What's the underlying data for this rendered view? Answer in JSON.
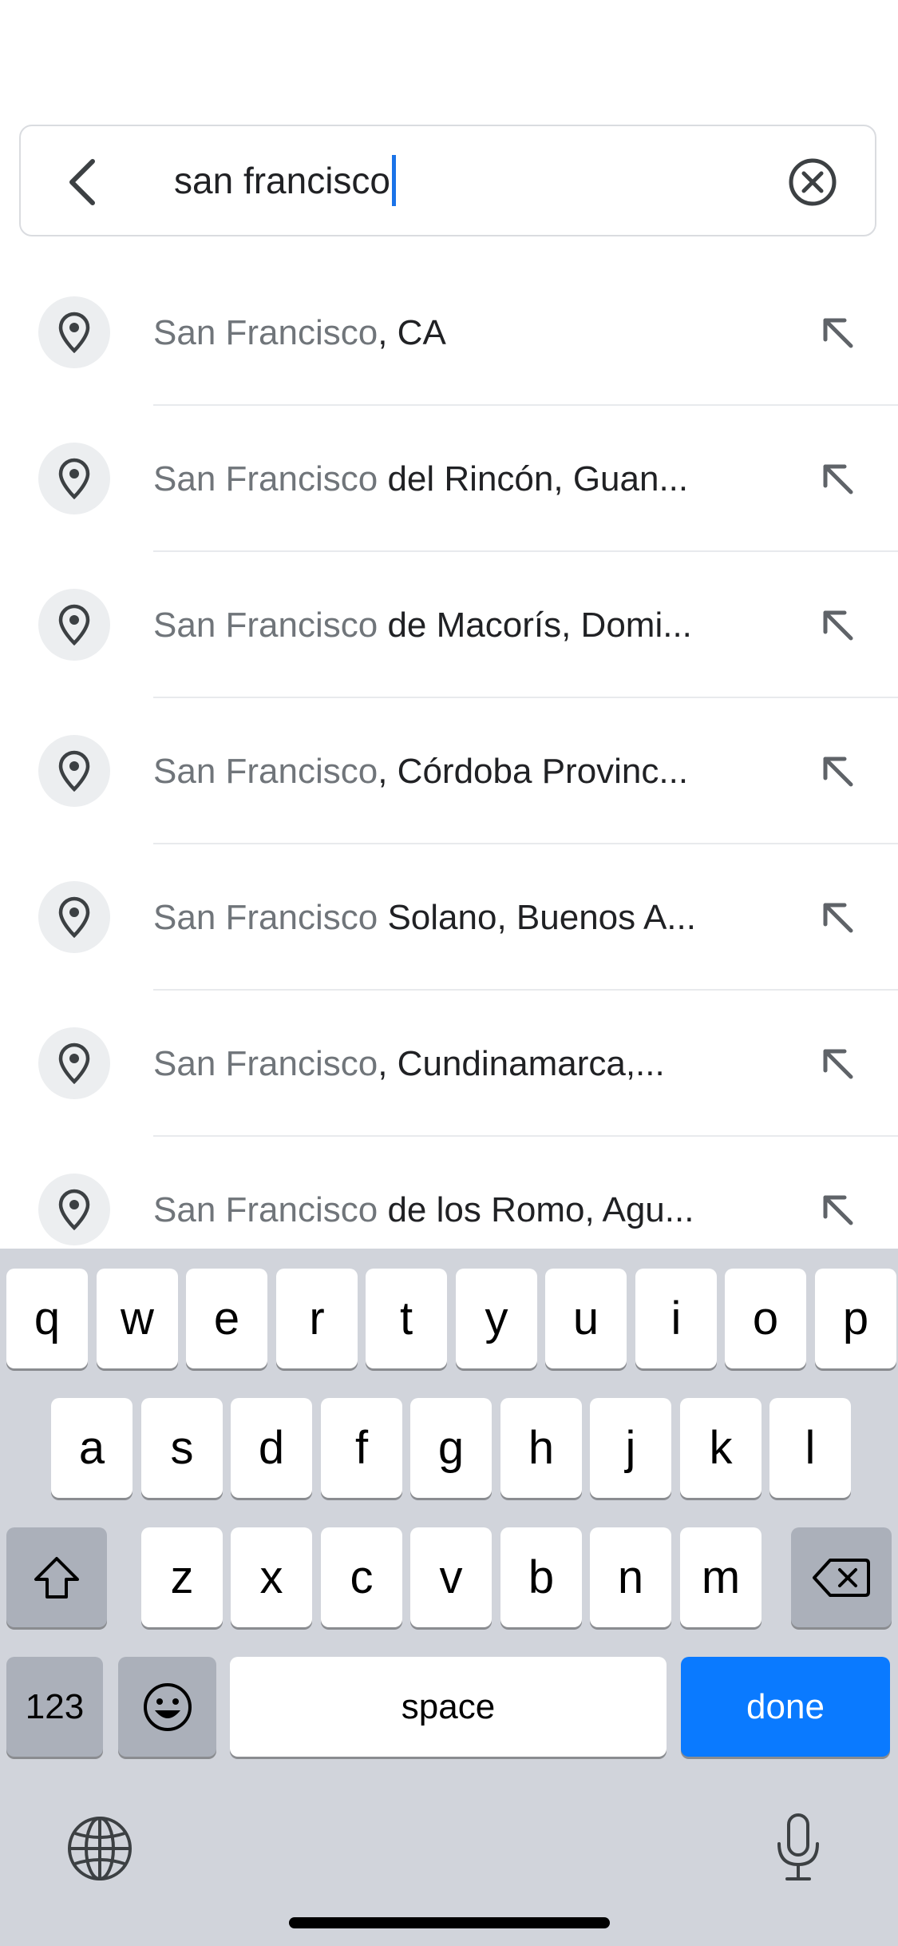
{
  "search": {
    "query": "san francisco"
  },
  "results": [
    {
      "match": "San Francisco",
      "rest": ", CA"
    },
    {
      "match": "San Francisco",
      "rest": " del Rincón, Guan..."
    },
    {
      "match": "San Francisco",
      "rest": " de Macorís, Domi..."
    },
    {
      "match": "San Francisco",
      "rest": ", Córdoba Provinc..."
    },
    {
      "match": "San Francisco",
      "rest": " Solano, Buenos A..."
    },
    {
      "match": "San Francisco",
      "rest": ", Cundinamarca,..."
    },
    {
      "match": "San Francisco",
      "rest": " de los Romo, Agu..."
    }
  ],
  "keyboard": {
    "row1": [
      "q",
      "w",
      "e",
      "r",
      "t",
      "y",
      "u",
      "i",
      "o",
      "p"
    ],
    "row2": [
      "a",
      "s",
      "d",
      "f",
      "g",
      "h",
      "j",
      "k",
      "l"
    ],
    "row3": [
      "z",
      "x",
      "c",
      "v",
      "b",
      "n",
      "m"
    ],
    "numbers_label": "123",
    "space_label": "space",
    "done_label": "done"
  },
  "colors": {
    "accent": "#0a7aff",
    "caret": "#1a73e8",
    "match_text": "#70757a",
    "keyboard_bg": "#d1d4db"
  },
  "icons": {
    "back": "chevron-left-icon",
    "clear": "clear-circle-icon",
    "result": "location-pin-icon",
    "fill": "arrow-up-left-icon",
    "shift": "shift-icon",
    "delete": "backspace-icon",
    "emoji": "emoji-icon",
    "globe": "globe-icon",
    "mic": "microphone-icon"
  }
}
